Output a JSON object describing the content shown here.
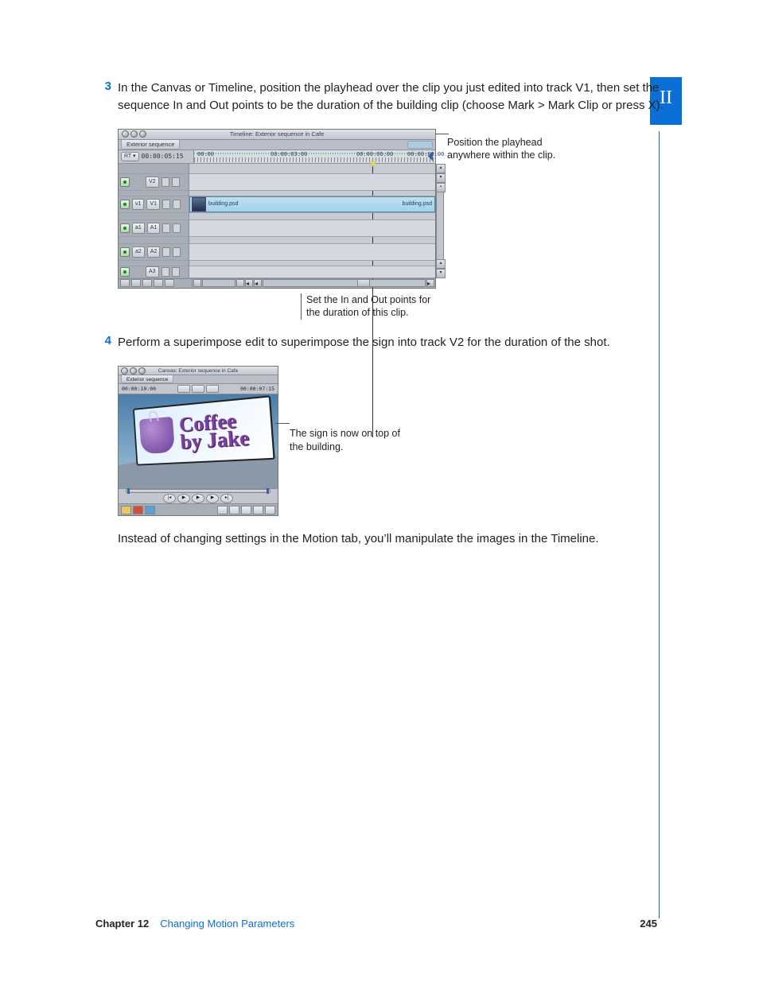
{
  "part_tab": "II",
  "steps": {
    "s3": {
      "num": "3",
      "text": "In the Canvas or Timeline, position the playhead over the clip you just edited into track V1, then set the sequence In and Out points to be the duration of the building clip (choose Mark > Mark Clip or press X)."
    },
    "s4": {
      "num": "4",
      "text": "Perform a superimpose edit to superimpose the sign into track V2 for the duration of the shot."
    }
  },
  "timeline": {
    "window_title": "Timeline: Exterior sequence in Cafe",
    "tab": "Exterior sequence",
    "rt_button": "RT ▾",
    "current_tc": "00:00:05:15",
    "ruler_tc": {
      "t0": "00:00",
      "t1": "00:00:03:00",
      "t2": "00:00:06:00",
      "t3": "00:00:09:00"
    },
    "tracks": {
      "v2": "V2",
      "v1_src": "v1",
      "v1_dst": "V1",
      "a1_src": "a1",
      "a1_dst": "A1",
      "a2_src": "a2",
      "a2_dst": "A2",
      "a3": "A3"
    },
    "clip": {
      "name": "building.psd"
    }
  },
  "captions": {
    "playhead": "Position the playhead anywhere within the clip.",
    "inout": "Set the In and Out points for the duration of this clip.",
    "sign": "The sign is now on top of the building."
  },
  "canvas": {
    "window_title": "Canvas: Exterior sequence in Cafe",
    "tab": "Exterior sequence",
    "left_tc": "00:00:10:00",
    "right_tc": "00:00:07:15",
    "sign_line1": "Coffee",
    "sign_line2": "by Jake"
  },
  "closing_para": "Instead of changing settings in the Motion tab, you’ll manipulate the images in the Timeline.",
  "footer": {
    "chapter": "Chapter 12",
    "title": "Changing Motion Parameters",
    "page": "245"
  }
}
